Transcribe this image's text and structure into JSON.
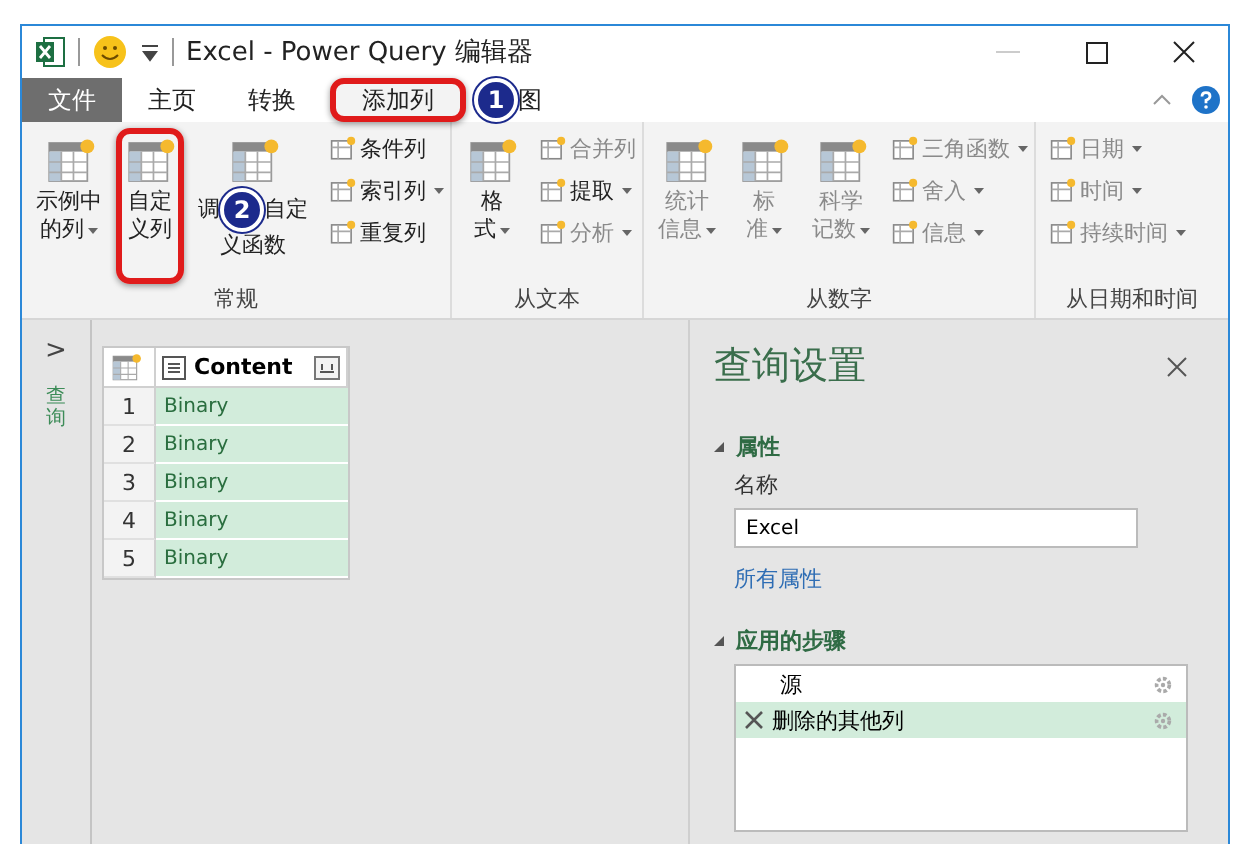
{
  "window": {
    "title": "Excel - Power Query 编辑器"
  },
  "tabs": [
    {
      "label": "文件",
      "kind": "file",
      "selected": false,
      "highlighted": false
    },
    {
      "label": "主页",
      "kind": "tab",
      "selected": false,
      "highlighted": false
    },
    {
      "label": "转换",
      "kind": "tab",
      "selected": false,
      "highlighted": false
    },
    {
      "label": "添加列",
      "kind": "tab",
      "selected": true,
      "highlighted": true
    },
    {
      "label": "图",
      "kind": "tab",
      "selected": false,
      "highlighted": false,
      "callout": "1"
    }
  ],
  "ribbon": {
    "groups": [
      {
        "title": "常规",
        "items": [
          {
            "kind": "large",
            "lines": [
              "示例中",
              "的列"
            ],
            "dropdown": true,
            "disabled": false,
            "highlighted": false
          },
          {
            "kind": "large",
            "lines": [
              "自定",
              "义列"
            ],
            "dropdown": false,
            "disabled": false,
            "highlighted": true
          },
          {
            "kind": "large",
            "lines": [
              "调",
              "自定",
              "义函数"
            ],
            "callout": "2",
            "dropdown": false,
            "disabled": false,
            "highlighted": false
          },
          {
            "kind": "stack",
            "items": [
              {
                "label": "条件列",
                "dropdown": false,
                "disabled": false
              },
              {
                "label": "索引列",
                "dropdown": true,
                "disabled": false
              },
              {
                "label": "重复列",
                "dropdown": false,
                "disabled": false
              }
            ]
          }
        ]
      },
      {
        "title": "从文本",
        "items": [
          {
            "kind": "large",
            "lines": [
              "格",
              "式"
            ],
            "dropdown": true,
            "disabled": false,
            "highlighted": false
          },
          {
            "kind": "stack",
            "items": [
              {
                "label": "合并列",
                "dropdown": false,
                "disabled": true
              },
              {
                "label": "提取",
                "dropdown": true,
                "disabled": false
              },
              {
                "label": "分析",
                "dropdown": true,
                "disabled": true
              }
            ]
          }
        ]
      },
      {
        "title": "从数字",
        "items": [
          {
            "kind": "large",
            "lines": [
              "统计",
              "信息"
            ],
            "dropdown": true,
            "disabled": true,
            "highlighted": false
          },
          {
            "kind": "large",
            "lines": [
              "标",
              "准"
            ],
            "dropdown": true,
            "disabled": true,
            "highlighted": false
          },
          {
            "kind": "large",
            "lines": [
              "科学",
              "记数"
            ],
            "dropdown": true,
            "disabled": true,
            "highlighted": false
          },
          {
            "kind": "stack",
            "items": [
              {
                "label": "三角函数",
                "dropdown": true,
                "disabled": true
              },
              {
                "label": "舍入",
                "dropdown": true,
                "disabled": true
              },
              {
                "label": "信息",
                "dropdown": true,
                "disabled": true
              }
            ]
          }
        ]
      },
      {
        "title": "从日期和时间",
        "items": [
          {
            "kind": "stack",
            "items": [
              {
                "label": "日期",
                "dropdown": true,
                "disabled": true
              },
              {
                "label": "时间",
                "dropdown": true,
                "disabled": true
              },
              {
                "label": "持续时间",
                "dropdown": true,
                "disabled": true
              }
            ]
          }
        ]
      }
    ]
  },
  "nav": {
    "label": "查询",
    "expand": ">"
  },
  "table": {
    "columns": [
      "Content"
    ],
    "rows": [
      {
        "index": "1",
        "value": "Binary"
      },
      {
        "index": "2",
        "value": "Binary"
      },
      {
        "index": "3",
        "value": "Binary"
      },
      {
        "index": "4",
        "value": "Binary"
      },
      {
        "index": "5",
        "value": "Binary"
      }
    ]
  },
  "settings": {
    "title": "查询设置",
    "properties_header": "属性",
    "name_label": "名称",
    "name_value": "Excel",
    "all_properties": "所有属性",
    "steps_header": "应用的步骤",
    "steps": [
      {
        "label": "源",
        "selected": false,
        "deletable": false
      },
      {
        "label": "删除的其他列",
        "selected": true,
        "deletable": true
      }
    ]
  }
}
